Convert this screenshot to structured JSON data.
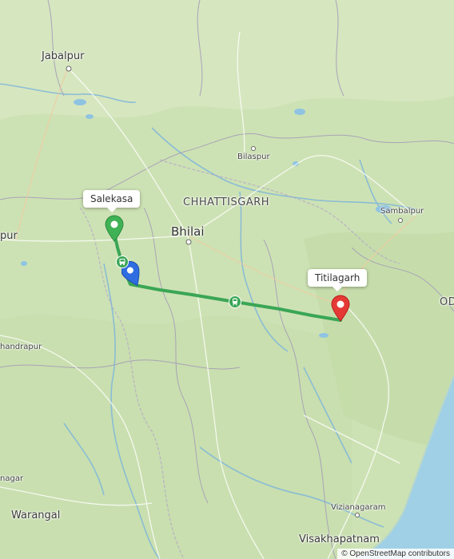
{
  "map": {
    "places": {
      "jabalpur": "Jabalpur",
      "bilaspur": "Bilaspur",
      "chhattisgarh": "CHHATTISGARH",
      "bhilai": "Bhilai",
      "sambalpur": "Sambalpur",
      "nagpur_partial": "pur",
      "chandrapur_partial": "handrapur",
      "nanagar_partial": "nagar",
      "warangal": "Warangal",
      "vizianagaram": "Vizianagaram",
      "visakhapatnam": "Visakhapatnam",
      "odisha_partial": "OD"
    },
    "route": {
      "start_label": "Salekasa",
      "end_label": "Titilagarh",
      "line_color": "#3aa655",
      "start_pin_color": "#3fb255",
      "end_pin_color": "#e53935",
      "current_pin_color": "#2f6de1",
      "mode_icons": [
        "bus-icon",
        "train-icon"
      ]
    },
    "attribution": "© OpenStreetMap contributors"
  }
}
